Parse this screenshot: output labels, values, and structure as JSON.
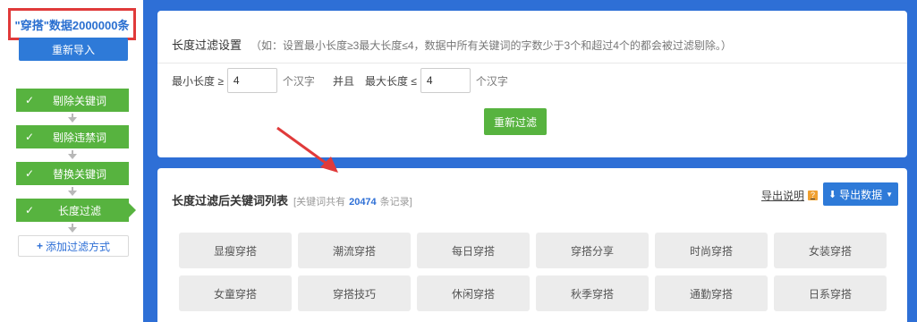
{
  "sidebar": {
    "dataset_title": "\"穿搭\"数据2000000条",
    "reimport_label": "重新导入",
    "steps": [
      {
        "label": "剔除关键词"
      },
      {
        "label": "剔除违禁词"
      },
      {
        "label": "替换关键词"
      },
      {
        "label": "长度过滤"
      }
    ],
    "add_label": "添加过滤方式"
  },
  "settings": {
    "title": "长度过滤设置",
    "hint": "（如：设置最小长度≥3最大长度≤4，数据中所有关键词的字数少于3个和超过4个的都会被过滤剔除。）",
    "min_label": "最小长度 ≥",
    "min_value": "4",
    "unit": "个汉字",
    "and_label": "并且",
    "max_label": "最大长度 ≤",
    "max_value": "4",
    "refilter_label": "重新过滤"
  },
  "list": {
    "title": "长度过滤后关键词列表",
    "record_prefix": "[关键词共有",
    "record_count": "20474",
    "record_suffix": "条记录]",
    "export_help": "导出说明",
    "export_label": "导出数据",
    "keywords": [
      "显瘦穿搭",
      "潮流穿搭",
      "每日穿搭",
      "穿搭分享",
      "时尚穿搭",
      "女装穿搭",
      "女童穿搭",
      "穿搭技巧",
      "休闲穿搭",
      "秋季穿搭",
      "通勤穿搭",
      "日系穿搭"
    ]
  },
  "colors": {
    "background": "#2e6fd6",
    "green": "#57b33f",
    "blue_button": "#2e7ad8",
    "highlight_border": "#e03a3a",
    "arrow": "#e03a3a"
  }
}
